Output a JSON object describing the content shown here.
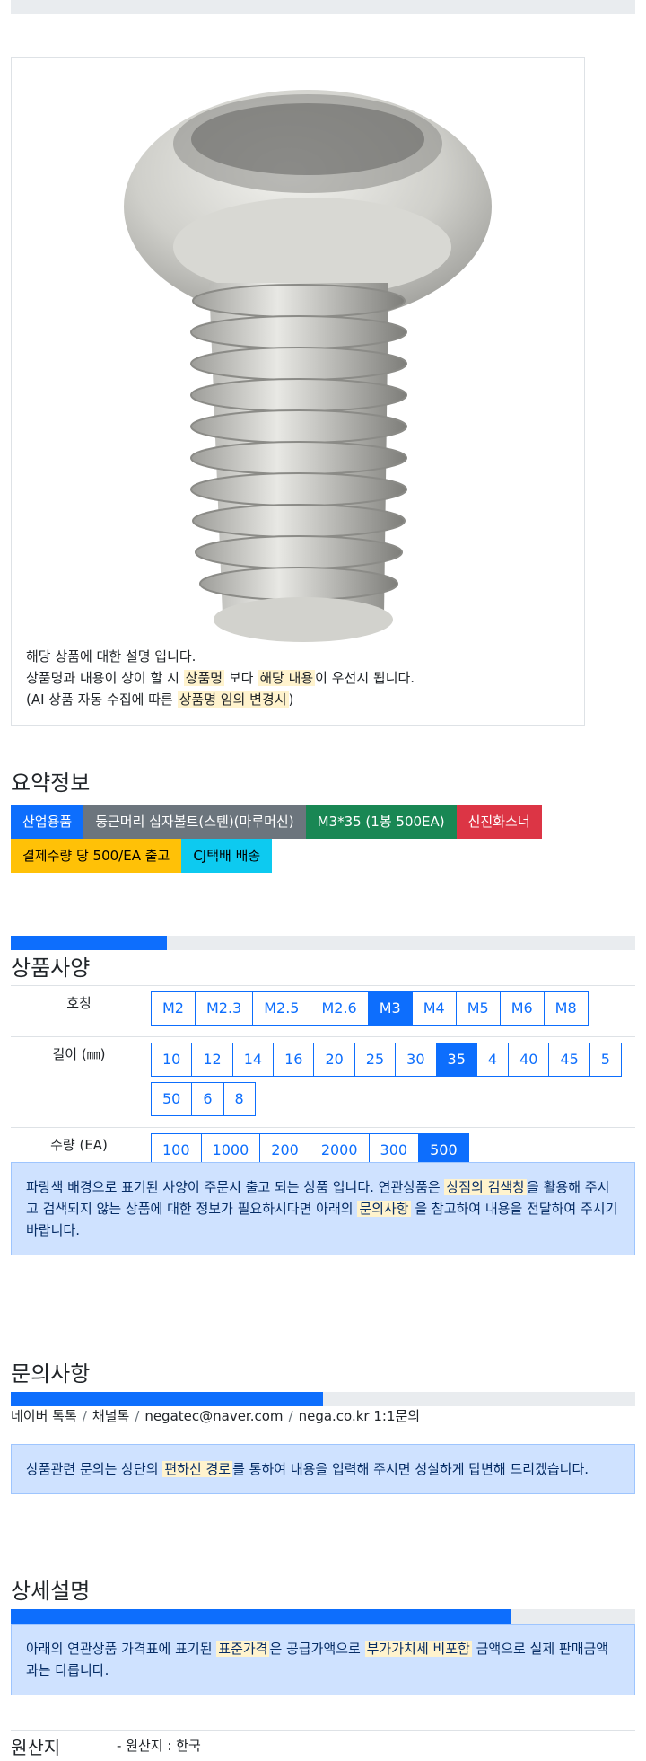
{
  "product": {
    "desc_line1": "해당 상품에 대한 설명 입니다.",
    "desc_line2_a": "상품명과 내용이 상이 할 시 ",
    "desc_line2_hl1": "상품명",
    "desc_line2_b": " 보다 ",
    "desc_line2_hl2": "해당 내용",
    "desc_line2_c": "이 우선시 됩니다.",
    "desc_line3_a": "(AI 상품 자동 수집에 따른 ",
    "desc_line3_hl": "상품명 임의 변경시",
    "desc_line3_b": ")"
  },
  "summary": {
    "title": "요약정보",
    "tags": [
      "산업용품",
      "둥근머리 십자볼트(스텐)(마루머신)",
      "M3*35 (1봉 500EA)",
      "신진화스너",
      "결제수량 당 500/EA 출고",
      "CJ택배 배송"
    ]
  },
  "spec": {
    "title": "상품사양",
    "progress": 0.25,
    "rows": [
      {
        "label": "호칭",
        "options": [
          "M2",
          "M2.3",
          "M2.5",
          "M2.6",
          "M3",
          "M4",
          "M5",
          "M6",
          "M8"
        ],
        "selected": "M3"
      },
      {
        "label": "길이 (㎜)",
        "options": [
          "10",
          "12",
          "14",
          "16",
          "20",
          "25",
          "30",
          "35",
          "4",
          "40",
          "45",
          "5",
          "50",
          "6",
          "8"
        ],
        "selected": "35"
      },
      {
        "label": "수량 (EA)",
        "options": [
          "100",
          "1000",
          "200",
          "2000",
          "300",
          "500"
        ],
        "selected": "500"
      }
    ],
    "notice_a": "파랑색 배경으로 표기된 사양이 주문시 출고 되는 상품 입니다. 연관상품은 ",
    "notice_hl1": "상점의 검색창",
    "notice_b": "을 활용해 주시고 검색되지 않는 상품에 대한 정보가 필요하시다면 아래의 ",
    "notice_hl2": "문의사항",
    "notice_c": " 을 참고하여 내용을 전달하여 주시기 바랍니다."
  },
  "inquiry": {
    "title": "문의사항",
    "progress": 0.5,
    "contacts": [
      "네이버 톡톡",
      "채널톡",
      "negatec@naver.com",
      "nega.co.kr 1:1문의"
    ],
    "notice_a": "상품관련 문의는 상단의 ",
    "notice_hl": "편하신 경로",
    "notice_b": "를 통하여 내용을 입력해 주시면 성실하게 답변해 드리겠습니다."
  },
  "detail": {
    "title": "상세설명",
    "progress": 0.8,
    "notice_a": "아래의 연관상품 가격표에 표기된 ",
    "notice_hl1": "표준가격",
    "notice_b": "은 공급가액으로 ",
    "notice_hl2": "부가가치세 비포함",
    "notice_c": " 금액으로 실제 판매금액과는 다릅니다."
  },
  "origin": {
    "label": "원산지",
    "value": "- 원산지 : 한국"
  }
}
